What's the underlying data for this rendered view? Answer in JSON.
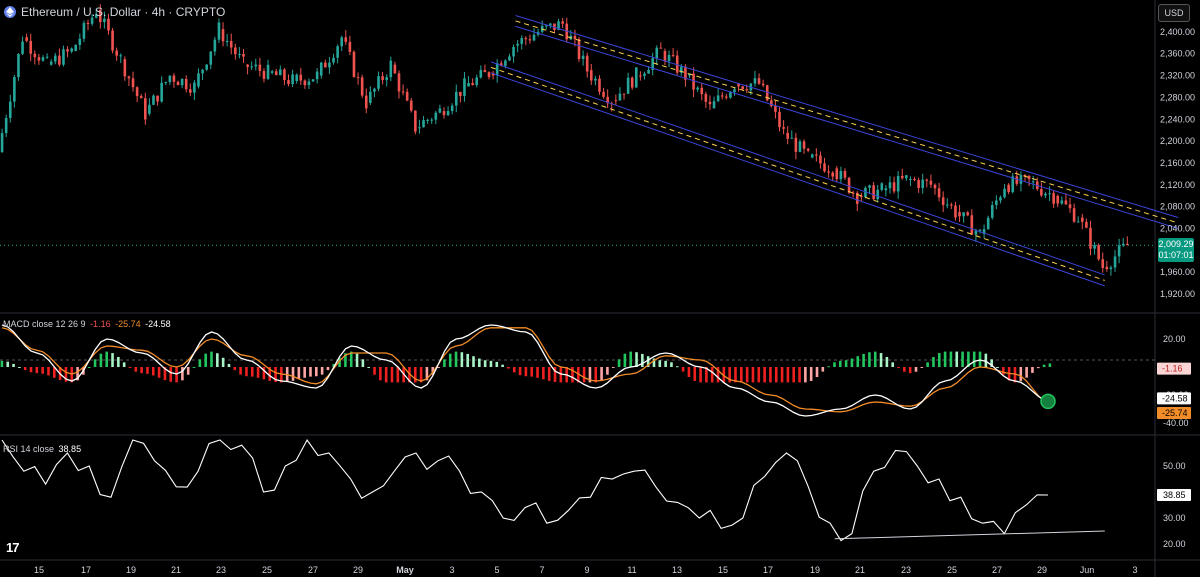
{
  "header": {
    "title": "Ethereum / U.S. Dollar · 4h · CRYPTO",
    "currency": "USD"
  },
  "price_tag": {
    "price": "2,009.29",
    "countdown": "01:07:01"
  },
  "macd": {
    "label": "MACD close 12 26 9",
    "hist_val": "-1.16",
    "signal_val": "-25.74",
    "macd_val": "-24.58",
    "ticks": [
      "20.00",
      "-20.00",
      "-40.00"
    ],
    "tags": {
      "hist": "-1.16",
      "macd": "-24.58",
      "signal": "-25.74"
    }
  },
  "rsi": {
    "label": "RSI 14 close",
    "value": "38.85",
    "ticks": [
      "50.00",
      "30.00",
      "20.00"
    ],
    "tag": "38.85"
  },
  "colors": {
    "up": "#26a69a",
    "down": "#ef5350",
    "channel": "#3b44d6",
    "mid": "#ffd54f",
    "macd_line": "#ffffff",
    "signal_line": "#f28c28",
    "hist_up": "#22c55e",
    "hist_down": "#ef2020"
  },
  "chart_data": [
    {
      "type": "candlestick",
      "title": "Ethereum / U.S. Dollar · 4h · CRYPTO",
      "x_ticks": [
        "15",
        "17",
        "19",
        "21",
        "23",
        "25",
        "27",
        "29",
        "May",
        "3",
        "5",
        "7",
        "9",
        "11",
        "13",
        "15",
        "17",
        "19",
        "21",
        "23",
        "25",
        "27",
        "29",
        "Jun",
        "3"
      ],
      "y_ticks": [
        2400,
        2360,
        2320,
        2280,
        2240,
        2200,
        2160,
        2120,
        2080,
        2040,
        1960,
        1920
      ],
      "ylim": [
        1900,
        2440
      ],
      "close_path": [
        {
          "x": "Apr 13",
          "y": 2180
        },
        {
          "x": "Apr 14",
          "y": 2390
        },
        {
          "x": "Apr 15",
          "y": 2340
        },
        {
          "x": "Apr 16",
          "y": 2365
        },
        {
          "x": "Apr 17",
          "y": 2440
        },
        {
          "x": "Apr 18",
          "y": 2350
        },
        {
          "x": "Apr 19",
          "y": 2250
        },
        {
          "x": "Apr 20",
          "y": 2320
        },
        {
          "x": "Apr 21",
          "y": 2300
        },
        {
          "x": "Apr 22",
          "y": 2405
        },
        {
          "x": "Apr 23",
          "y": 2340
        },
        {
          "x": "Apr 24",
          "y": 2325
        },
        {
          "x": "Apr 25",
          "y": 2310
        },
        {
          "x": "Apr 26",
          "y": 2320
        },
        {
          "x": "Apr 27",
          "y": 2390
        },
        {
          "x": "Apr 28",
          "y": 2270
        },
        {
          "x": "Apr 29",
          "y": 2340
        },
        {
          "x": "Apr 30",
          "y": 2225
        },
        {
          "x": "May 1",
          "y": 2255
        },
        {
          "x": "May 2",
          "y": 2300
        },
        {
          "x": "May 3",
          "y": 2325
        },
        {
          "x": "May 4",
          "y": 2375
        },
        {
          "x": "May 5",
          "y": 2400
        },
        {
          "x": "May 6",
          "y": 2415
        },
        {
          "x": "May 7",
          "y": 2330
        },
        {
          "x": "May 8",
          "y": 2275
        },
        {
          "x": "May 9",
          "y": 2320
        },
        {
          "x": "May 10",
          "y": 2365
        },
        {
          "x": "May 11",
          "y": 2320
        },
        {
          "x": "May 12",
          "y": 2260
        },
        {
          "x": "May 13",
          "y": 2305
        },
        {
          "x": "May 14",
          "y": 2305
        },
        {
          "x": "May 15",
          "y": 2215
        },
        {
          "x": "May 16",
          "y": 2170
        },
        {
          "x": "May 17",
          "y": 2150
        },
        {
          "x": "May 18",
          "y": 2100
        },
        {
          "x": "May 19",
          "y": 2110
        },
        {
          "x": "May 20",
          "y": 2130
        },
        {
          "x": "May 21",
          "y": 2120
        },
        {
          "x": "May 22",
          "y": 2070
        },
        {
          "x": "May 23",
          "y": 2030
        },
        {
          "x": "May 24",
          "y": 2120
        },
        {
          "x": "May 25",
          "y": 2125
        },
        {
          "x": "May 26",
          "y": 2100
        },
        {
          "x": "May 27",
          "y": 2060
        },
        {
          "x": "May 28",
          "y": 1970
        },
        {
          "x": "May 29",
          "y": 2009.29
        }
      ],
      "channel": {
        "upper": [
          {
            "x": "May 4",
            "y": 2420
          },
          {
            "x": "May 31",
            "y": 2050
          }
        ],
        "lower": [
          {
            "x": "May 3",
            "y": 2335
          },
          {
            "x": "May 28",
            "y": 1945
          }
        ]
      },
      "last_price": 2009.29
    },
    {
      "type": "line",
      "title": "MACD close 12 26 9",
      "y_ticks": [
        20,
        -20,
        -40
      ],
      "ylim": [
        -45,
        35
      ],
      "series": [
        {
          "name": "-24.58",
          "values": [
            30,
            10,
            -10,
            20,
            10,
            -5,
            25,
            5,
            -10,
            -15,
            15,
            5,
            -15,
            20,
            30,
            25,
            -5,
            -15,
            0,
            10,
            0,
            -15,
            -25,
            -35,
            -30,
            -20,
            -30,
            -10,
            5,
            -10,
            -24.58
          ]
        },
        {
          "name": "-25.74",
          "values": [
            28,
            12,
            -5,
            15,
            12,
            0,
            20,
            8,
            -5,
            -12,
            10,
            10,
            -10,
            15,
            28,
            28,
            0,
            -10,
            -5,
            8,
            5,
            -10,
            -20,
            -30,
            -32,
            -25,
            -28,
            -15,
            0,
            -5,
            -25.74
          ]
        }
      ],
      "histogram_last": -1.16
    },
    {
      "type": "line",
      "title": "RSI 14 close",
      "y_ticks": [
        50,
        30,
        20
      ],
      "ylim": [
        15,
        60
      ],
      "values": [
        60,
        48,
        43,
        55,
        50,
        38,
        60,
        52,
        42,
        48,
        60,
        58,
        40,
        50,
        60,
        55,
        45,
        40,
        48,
        55,
        52,
        48,
        40,
        30,
        34,
        28,
        33,
        38,
        45,
        48,
        42,
        36,
        30,
        26,
        30,
        46,
        55,
        42,
        28,
        24,
        48,
        56,
        50,
        45,
        38,
        28,
        24,
        35,
        38.85
      ],
      "divergence_line": [
        {
          "x": "May 17",
          "y": 22
        },
        {
          "x": "May 28",
          "y": 25
        }
      ]
    }
  ]
}
